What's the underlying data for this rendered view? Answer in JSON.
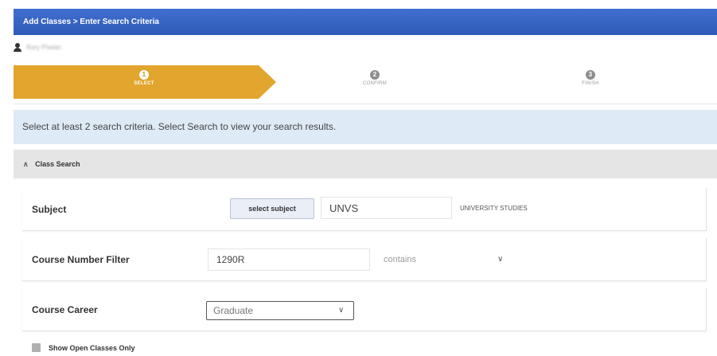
{
  "header": {
    "breadcrumb": "Add Classes > Enter Search Criteria"
  },
  "user": {
    "name": "Rory Phelan"
  },
  "steps": [
    {
      "number": "1",
      "label": "SELECT",
      "state": "active"
    },
    {
      "number": "2",
      "label": "CONFIRM",
      "state": "inactive"
    },
    {
      "number": "3",
      "label": "FINISH",
      "state": "inactive"
    }
  ],
  "info": {
    "message": "Select at least 2 search criteria. Select Search to view your search results."
  },
  "section": {
    "title": "Class Search"
  },
  "subject": {
    "label": "Subject",
    "button_label": "select subject",
    "value": "UNVS",
    "description": "UNIVERSITY STUDIES"
  },
  "course_number": {
    "label": "Course Number Filter",
    "value": "1290R",
    "operator": "contains"
  },
  "course_career": {
    "label": "Course Career",
    "value": "Graduate"
  },
  "open_only": {
    "label": "Show Open Classes Only",
    "checked": false
  },
  "colors": {
    "header_blue": "#3466c4",
    "step_active": "#e2a52d",
    "info_bg": "#deeaf6",
    "section_bg": "#e5e5e5"
  }
}
